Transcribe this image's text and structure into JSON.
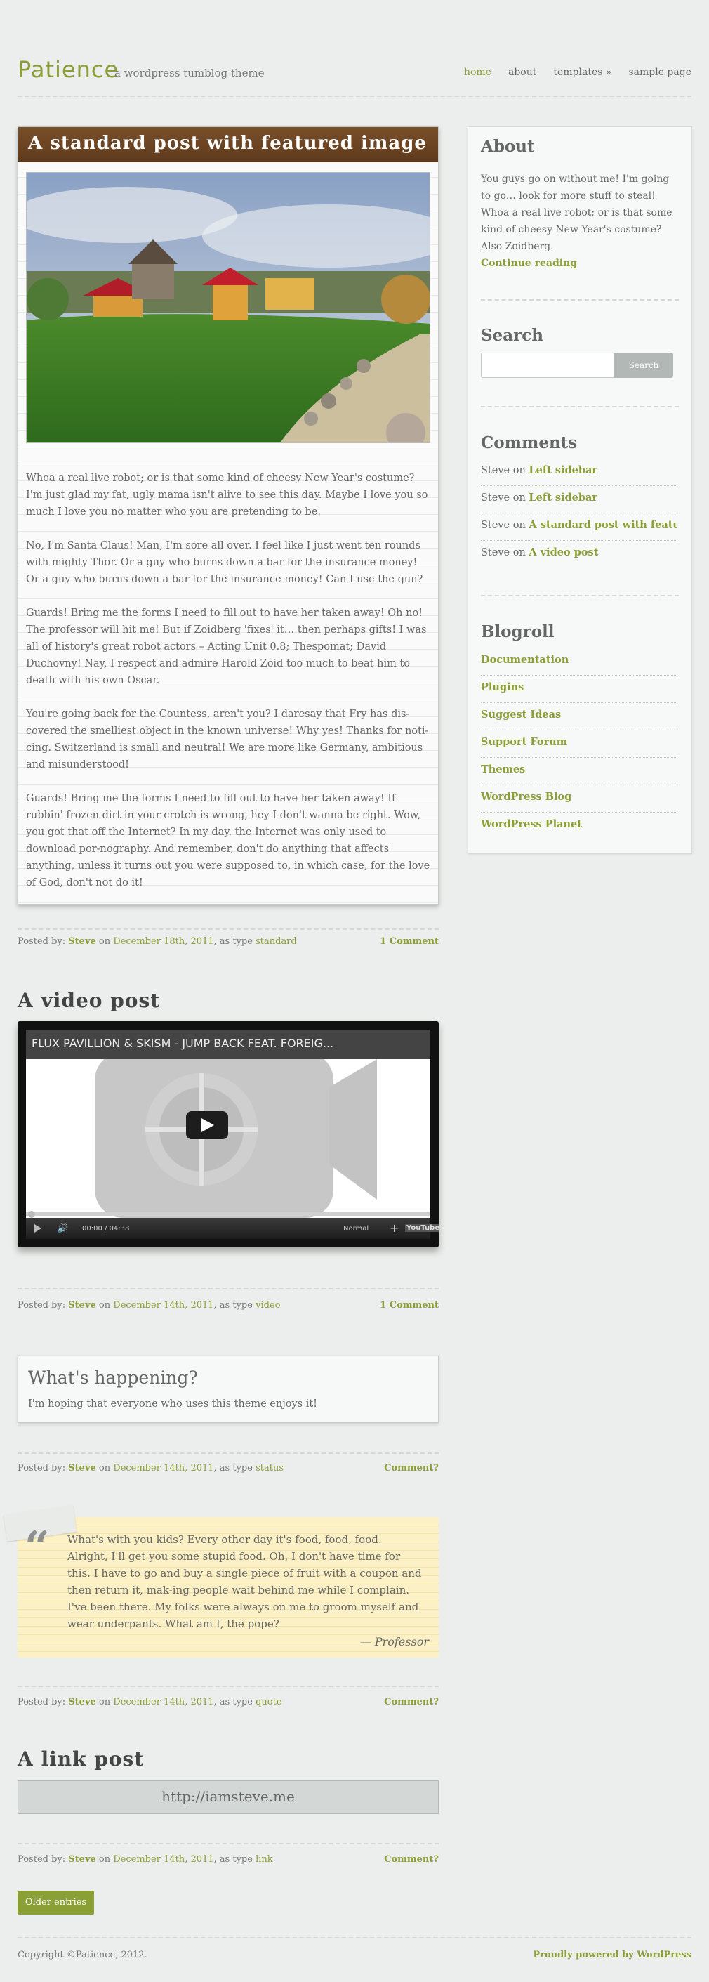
{
  "header": {
    "title": "Patience",
    "tagline": "a wordpress tumblog theme",
    "nav": [
      "home",
      "about",
      "templates »",
      "sample page"
    ]
  },
  "post1": {
    "title": "A standard post with featured image",
    "paragraphs": [
      "Whoa a real live robot; or is that some kind of cheesy New Year's costume? I'm just glad my fat, ugly mama isn't alive to see this day. Maybe I love you so much I love you no matter who you are pretending to be.",
      "No, I'm Santa Claus! Man, I'm sore all over. I feel like I just went ten rounds with mighty Thor. Or a guy who burns down a bar for the insurance money! Or a guy who burns down a bar for the insurance money! Can I use the gun?",
      "Guards! Bring me the forms I need to fill out to have her taken away! Oh no! The professor will hit me! But if Zoidberg 'fixes' it… then perhaps gifts! I was all of history's great robot actors – Acting Unit 0.8; Thespomat; David Duchovny! Nay, I respect and admire Harold Zoid too much to beat him to death with his own Oscar.",
      "You're going back for the Countess, aren't you? I daresay that Fry has dis-covered the smelliest object in the known universe! Why yes! Thanks for noti-cing. Switzerland is small and neutral! We are more like Germany, ambitious and misunderstood!",
      "Guards! Bring me the forms I need to fill out to have her taken away! If rubbin' frozen dirt in your crotch is wrong, hey I don't wanna be right. Wow, you got that off the Internet? In my day, the Internet was only used to download por-nography. And remember, don't do anything that affects anything, unless it turns out you were supposed to, in which case, for the love of God, don't not do it!"
    ],
    "meta": {
      "prefix": "Posted by:",
      "author": "Steve",
      "on": "on",
      "date": "December 18th, 2011",
      "as_type": ", as type",
      "type": "standard",
      "comments": "1 Comment"
    }
  },
  "post2": {
    "title": "A video post",
    "video_title": "FLUX PAVILLION & SKISM - JUMP BACK FEAT. FOREIG...",
    "time": "00:00 / 04:38",
    "quality": "Normal",
    "logo": "YouTube",
    "meta": {
      "prefix": "Posted by:",
      "author": "Steve",
      "on": "on",
      "date": "December 14th, 2011",
      "as_type": ", as type",
      "type": "video",
      "comments": "1 Comment"
    }
  },
  "post3": {
    "title": "What's happening?",
    "text": "I'm hoping that everyone who uses this theme enjoys it!",
    "meta": {
      "prefix": "Posted by:",
      "author": "Steve",
      "on": "on",
      "date": "December 14th, 2011",
      "as_type": ", as type",
      "type": "status",
      "comments": "Comment?"
    }
  },
  "post4": {
    "quote": "What's with you kids? Every other day it's food, food, food. Alright, I'll get you some stupid food. Oh, I don't have time for this. I have to go and buy a single piece of fruit with a coupon and then return it, mak-ing people wait behind me while I complain. I've been there. My folks were always on me to groom myself and wear underpants. What am I, the pope?",
    "author": "— Professor",
    "meta": {
      "prefix": "Posted by:",
      "author": "Steve",
      "on": "on",
      "date": "December 14th, 2011",
      "as_type": ", as type",
      "type": "quote",
      "comments": "Comment?"
    }
  },
  "post5": {
    "title": "A link post",
    "url": "http://iamsteve.me",
    "meta": {
      "prefix": "Posted by:",
      "author": "Steve",
      "on": "on",
      "date": "December 14th, 2011",
      "as_type": ", as type",
      "type": "link",
      "comments": "Comment?"
    }
  },
  "older_entries": "Older entries",
  "footer": {
    "copyright": "Copyright ©Patience, 2012.",
    "powered": "Proudly powered by WordPress"
  },
  "sidebar": {
    "about_title": "About",
    "about_text": "You guys go on without me! I'm going to go… look for more stuff to steal! Whoa a real live robot; or is that some kind of cheesy New Year's costume? Also Zoidberg.",
    "about_link": "Continue reading",
    "search_title": "Search",
    "search_button": "Search",
    "comments_title": "Comments",
    "comments": [
      {
        "who": "Steve",
        "on": "on",
        "post": "Left sidebar"
      },
      {
        "who": "Steve",
        "on": "on",
        "post": "Left sidebar"
      },
      {
        "who": "Steve",
        "on": "on",
        "post": "A standard post with featur…"
      },
      {
        "who": "Steve",
        "on": "on",
        "post": "A video post"
      }
    ],
    "blogroll_title": "Blogroll",
    "blogroll": [
      "Documentation",
      "Plugins",
      "Suggest Ideas",
      "Support Forum",
      "Themes",
      "WordPress Blog",
      "WordPress Planet"
    ]
  },
  "colors": {
    "accent": "#8a9f35",
    "title_bar": "#6d4524",
    "background": "#eceeed"
  }
}
